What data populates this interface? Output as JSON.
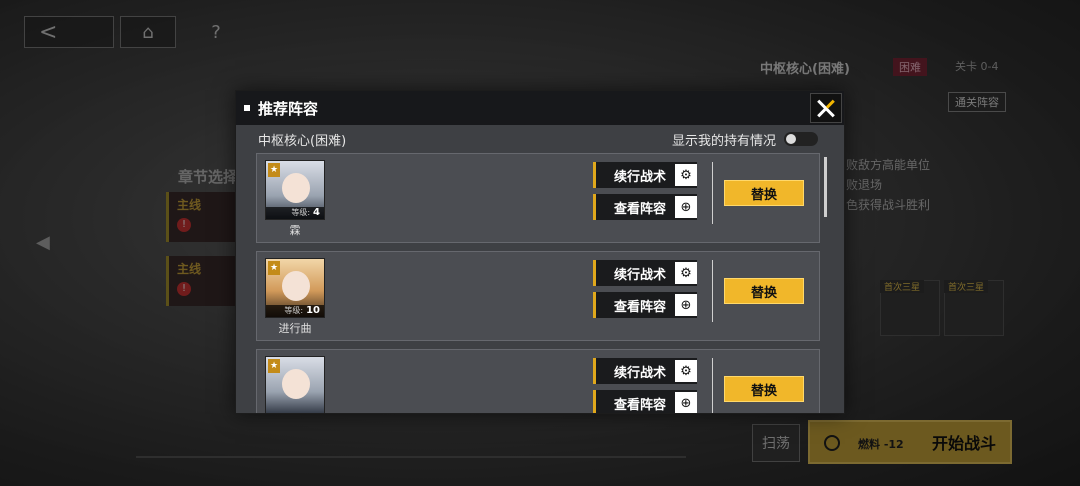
{
  "nav": {
    "back_glyph": "<",
    "home_glyph": "⌂",
    "help_glyph": "?"
  },
  "chapter": {
    "title": "章节选择",
    "cards": [
      {
        "tag": "主线"
      },
      {
        "tag": "主线"
      }
    ]
  },
  "stage": {
    "name": "中枢核心(困难)",
    "difficulty": "困难",
    "code": "关卡 0-4",
    "clear_team_label": "通关阵容",
    "objectives": [
      "败敌方高能单位",
      "败退场",
      "色获得战斗胜利"
    ],
    "reward_tags": [
      "首次三星",
      "首次三星"
    ]
  },
  "bottom": {
    "sweep_label": "扫荡",
    "fuel_label": "燃料 -12",
    "start_label": "开始战斗"
  },
  "modal": {
    "title": "推荐阵容",
    "stage_label": "中枢核心(困难)",
    "toggle_label": "显示我的持有情况",
    "toggle_on": false,
    "entries": [
      {
        "name": "霖",
        "level_label": "等级:",
        "level": "4",
        "tactic_label": "续行战术",
        "view_label": "查看阵容",
        "replace_label": "替换"
      },
      {
        "name": "进行曲",
        "level_label": "等级:",
        "level": "10",
        "tactic_label": "续行战术",
        "view_label": "查看阵容",
        "replace_label": "替换"
      },
      {
        "name": "",
        "level_label": "",
        "level": "",
        "tactic_label": "续行战术",
        "view_label": "查看阵容",
        "replace_label": "替换"
      }
    ]
  },
  "colors": {
    "accent": "#f1b72a",
    "danger": "#7a2535"
  },
  "icons": [
    "back-icon",
    "home-icon",
    "help-icon",
    "close-icon",
    "gear-timer-icon",
    "magnifier-icon",
    "star-rank-icon",
    "fuel-icon"
  ]
}
